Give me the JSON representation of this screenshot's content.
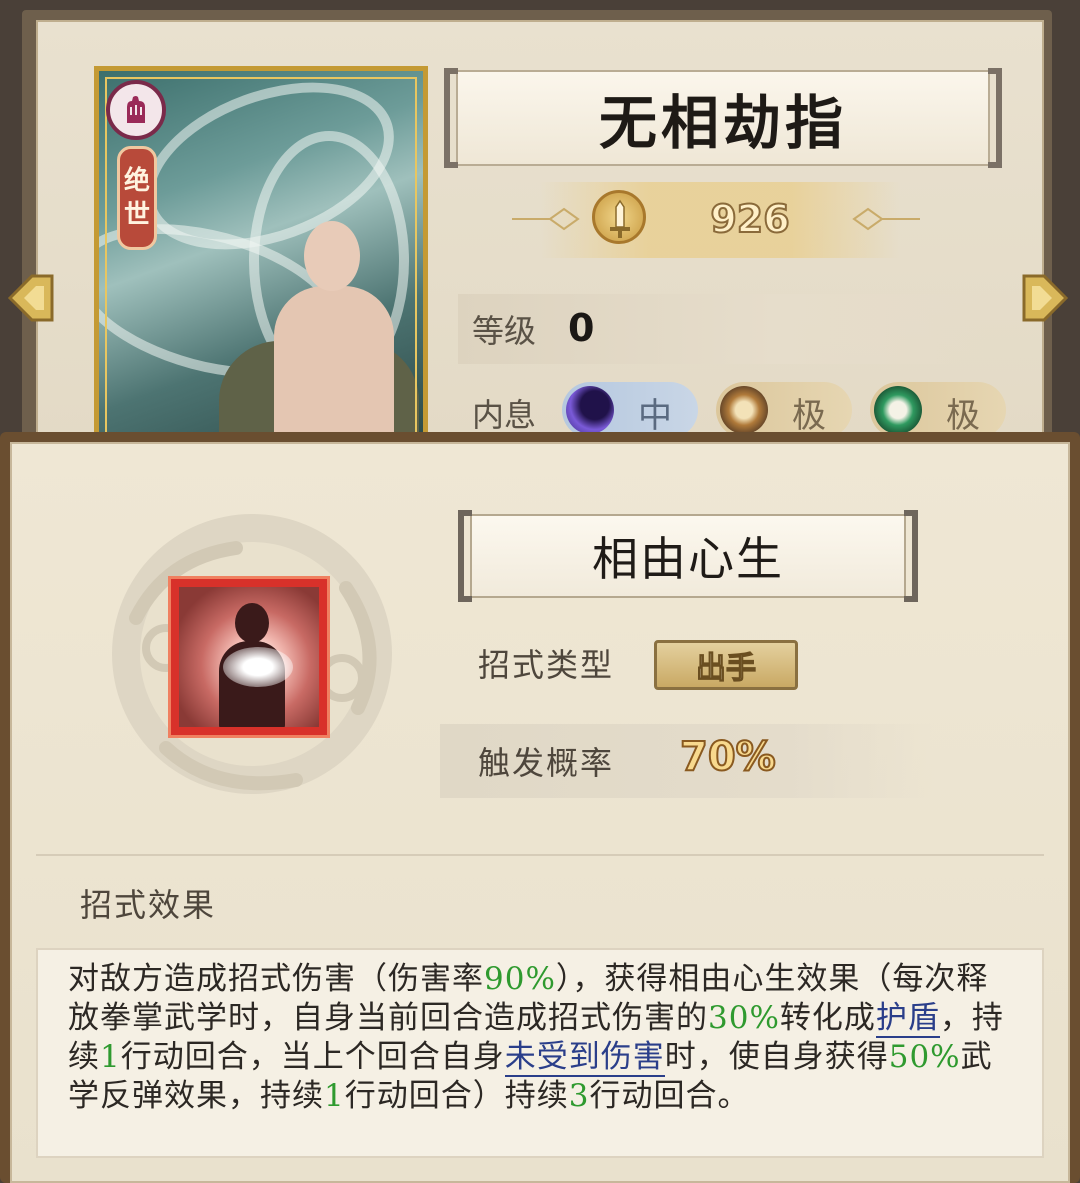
{
  "card": {
    "rank_char_1": "绝",
    "rank_char_2": "世",
    "class_icon": "fist-icon",
    "title": "无相劫指",
    "power": "926",
    "level_label": "等级",
    "level_value": "0",
    "inner_label": "内息",
    "inner_chips": [
      {
        "label": "中",
        "color": "#7a5ad8"
      },
      {
        "label": "极",
        "color": "#b07a3a"
      },
      {
        "label": "极",
        "color": "#2f9a60"
      }
    ]
  },
  "skill": {
    "name": "相由心生",
    "type_label": "招式类型",
    "type_value": "出手",
    "chance_label": "触发概率",
    "chance_value": "70%",
    "effect_heading": "招式效果",
    "description": {
      "s1": "对敌方造成招式伤害（伤害率",
      "v1": "90%",
      "s2": "），获得相由心生效果（每次释放拳掌武学时，自身当前回合造成招式伤害的",
      "v2": "30%",
      "s3": "转化成",
      "k1": "护盾",
      "s4": "，持续",
      "v3": "1",
      "s5": "行动回合，当上个回合自身",
      "k2": "未受到伤害",
      "s6": "时，使自身获得",
      "v4": "50%",
      "s7": "武学反弹效果，持续",
      "v5": "1",
      "s8": "行动回合）持续",
      "v6": "3",
      "s9": "行动回合。"
    }
  },
  "colors": {
    "accent_gold": "#c49a34",
    "highlight_green": "#2f9a2f",
    "keyword_blue": "#2a3e8a",
    "skill_icon_red": "#d8312a"
  }
}
